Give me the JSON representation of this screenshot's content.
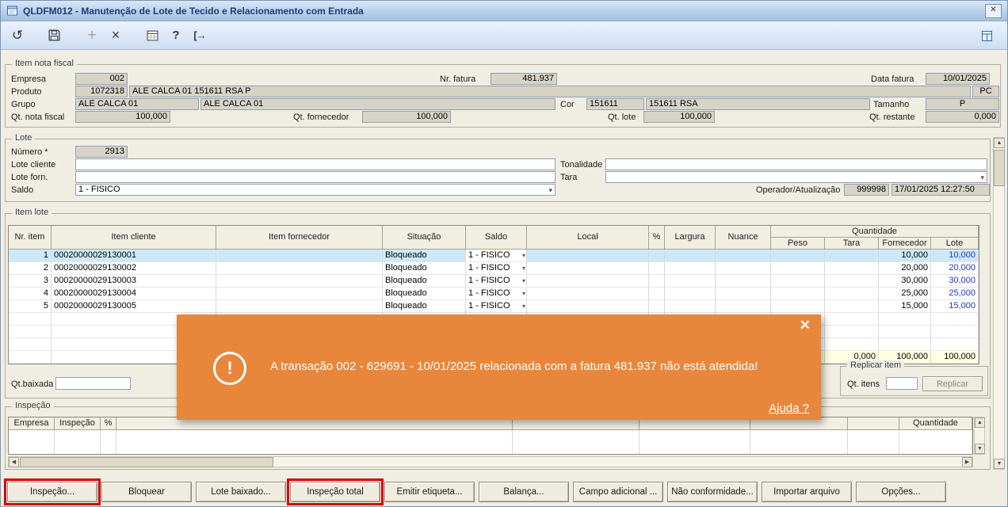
{
  "window": {
    "title": "QLDFM012 - Manutenção de Lote de Tecido e Relacionamento com Entrada",
    "close_glyph": "✕"
  },
  "toolbar": {
    "undo_glyph": "↺",
    "add_glyph": "+",
    "delete_glyph": "×",
    "help_glyph": "?",
    "exit_glyph": "[→"
  },
  "nota_fiscal": {
    "legend": "Item nota fiscal",
    "empresa_label": "Empresa",
    "empresa": "002",
    "nr_fatura_label": "Nr. fatura",
    "nr_fatura": "481.937",
    "data_fatura_label": "Data fatura",
    "data_fatura": "10/01/2025",
    "produto_label": "Produto",
    "produto": "1072318",
    "produto_desc": "ALE CALCA 01 151611 RSA P",
    "unidade": "PC",
    "grupo_label": "Grupo",
    "grupo": "ALE CALCA 01",
    "grupo_desc": "ALE CALCA 01",
    "cor_label": "Cor",
    "cor": "151611",
    "cor_desc": "151611 RSA",
    "tamanho_label": "Tamanho",
    "tamanho": "P",
    "qt_nota_fiscal_label": "Qt. nota fiscal",
    "qt_nota_fiscal": "100,000",
    "qt_fornecedor_label": "Qt. fornecedor",
    "qt_fornecedor": "100,000",
    "qt_lote_label": "Qt. lote",
    "qt_lote": "100,000",
    "qt_restante_label": "Qt. restante",
    "qt_restante": "0,000"
  },
  "lote": {
    "legend": "Lote",
    "numero_label": "Número *",
    "numero": "2913",
    "lote_cliente_label": "Lote cliente",
    "lote_cliente": "",
    "tonalidade_label": "Tonalidade",
    "tonalidade": "",
    "lote_forn_label": "Lote forn.",
    "lote_forn": "",
    "tara_label": "Tara",
    "tara": "",
    "saldo_label": "Saldo",
    "saldo": "1 - FISICO",
    "operador_label": "Operador/Atualização",
    "operador": "999998",
    "atualizacao": "17/01/2025 12:27:50"
  },
  "item_lote": {
    "legend": "Item lote",
    "header": {
      "nr_item": "Nr. item",
      "item_cliente": "Item cliente",
      "item_fornecedor": "Item fornecedor",
      "situacao": "Situação",
      "saldo": "Saldo",
      "local": "Local",
      "flag": "%",
      "largura": "Largura",
      "nuance": "Nuance",
      "quantidade": "Quantidade",
      "peso": "Peso",
      "tara": "Tara",
      "fornecedor": "Fornecedor",
      "lote": "Lote"
    },
    "rows": [
      {
        "nr": "1",
        "item_cliente": "00020000029130001",
        "item_fornecedor": "",
        "situacao": "Bloqueado",
        "saldo": "1 - FISICO",
        "local": "",
        "largura": "",
        "nuance": "",
        "peso": "",
        "tara": "",
        "fornecedor": "10,000",
        "lote": "10,000",
        "selected": true
      },
      {
        "nr": "2",
        "item_cliente": "00020000029130002",
        "item_fornecedor": "",
        "situacao": "Bloqueado",
        "saldo": "1 - FISICO",
        "local": "",
        "largura": "",
        "nuance": "",
        "peso": "",
        "tara": "",
        "fornecedor": "20,000",
        "lote": "20,000",
        "selected": false
      },
      {
        "nr": "3",
        "item_cliente": "00020000029130003",
        "item_fornecedor": "",
        "situacao": "Bloqueado",
        "saldo": "1 - FISICO",
        "local": "",
        "largura": "",
        "nuance": "",
        "peso": "",
        "tara": "",
        "fornecedor": "30,000",
        "lote": "30,000",
        "selected": false
      },
      {
        "nr": "4",
        "item_cliente": "00020000029130004",
        "item_fornecedor": "",
        "situacao": "Bloqueado",
        "saldo": "1 - FISICO",
        "local": "",
        "largura": "",
        "nuance": "",
        "peso": "",
        "tara": "",
        "fornecedor": "25,000",
        "lote": "25,000",
        "selected": false
      },
      {
        "nr": "5",
        "item_cliente": "00020000029130005",
        "item_fornecedor": "",
        "situacao": "Bloqueado",
        "saldo": "1 - FISICO",
        "local": "",
        "largura": "",
        "nuance": "",
        "peso": "",
        "tara": "",
        "fornecedor": "15,000",
        "lote": "15,000",
        "selected": false
      }
    ],
    "totals": {
      "peso": "",
      "tara": "0,000",
      "fornecedor": "100,000",
      "lote": "100,000"
    },
    "qt_baixada_label": "Qt.baixada",
    "qt_baixada": "",
    "replicar_legend": "Replicar item",
    "qt_itens_label": "Qt. itens",
    "qt_itens": "",
    "replicar_button": "Replicar"
  },
  "inspecao": {
    "legend": "Inspeção",
    "header": {
      "empresa": "Empresa",
      "inspecao": "Inspeção",
      "flag": "%",
      "quantidade": "Quantidade"
    }
  },
  "dialog": {
    "exclamation": "!",
    "message": "A transação 002 - 629691 - 10/01/2025 relacionada com a fatura 481.937 não está atendida!",
    "help": "Ajuda ?",
    "close_glyph": "✕"
  },
  "actions": [
    {
      "label": "Inspeção...",
      "highlighted": true
    },
    {
      "label": "Bloquear",
      "highlighted": false
    },
    {
      "label": "Lote baixado...",
      "highlighted": false
    },
    {
      "label": "Inspeção total",
      "highlighted": true
    },
    {
      "label": "Emitir etiqueta...",
      "highlighted": false
    },
    {
      "label": "Balança...",
      "highlighted": false
    },
    {
      "label": "Campo adicional ...",
      "highlighted": false
    },
    {
      "label": "Não conformidade...",
      "highlighted": false
    },
    {
      "label": "Importar arquivo",
      "highlighted": false
    },
    {
      "label": "Opções...",
      "highlighted": false
    }
  ],
  "colors": {
    "dialog_orange": "#E8873C",
    "annotation_red": "#D60000",
    "selected_row_blue": "#CDE9F9",
    "totals_yellow": "#FFFFE1",
    "lote_value_blue": "#2233CC"
  }
}
